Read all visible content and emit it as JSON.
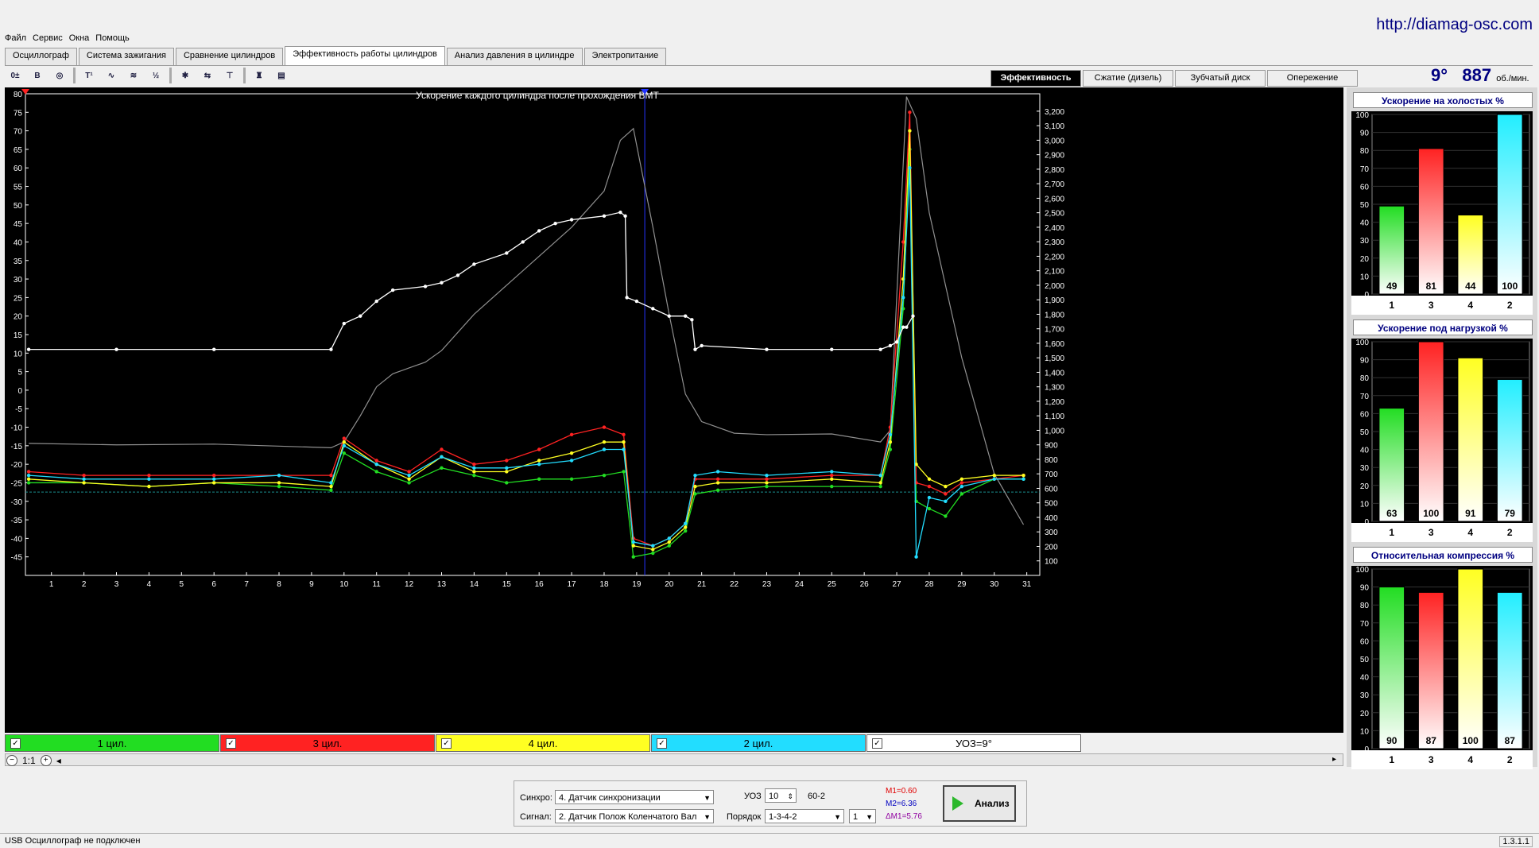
{
  "url": "http://diamag-osc.com",
  "menu": [
    "Файл",
    "Сервис",
    "Окна",
    "Помощь"
  ],
  "tabs": [
    {
      "label": "Осциллограф",
      "active": false
    },
    {
      "label": "Система зажигания",
      "active": false
    },
    {
      "label": "Сравнение цилиндров",
      "active": false
    },
    {
      "label": "Эффективность работы цилиндров",
      "active": true
    },
    {
      "label": "Анализ давления в цилиндре",
      "active": false
    },
    {
      "label": "Электропитание",
      "active": false
    }
  ],
  "toolbar_icons": [
    "zoom-tool-icon",
    "bold-b-icon",
    "rpm-icon",
    "t10-icon",
    "wave-icon",
    "vvti-icon",
    "alg-icon",
    "injector-icon",
    "timing-icon",
    "tdc-icon",
    "gauge-icon",
    "table-icon"
  ],
  "mode_tabs": [
    {
      "label": "Эффективность",
      "active": true
    },
    {
      "label": "Сжатие (дизель)",
      "active": false
    },
    {
      "label": "Зубчатый диск",
      "active": false
    },
    {
      "label": "Опережение",
      "active": false
    }
  ],
  "rpm": {
    "angle": "9°",
    "value": "887",
    "unit": "об./мин."
  },
  "chart_data": {
    "type": "line",
    "title": "Ускорение каждого цилиндра после прохождения ВМТ",
    "x_ticks": [
      "1",
      "2",
      "3",
      "4",
      "5",
      "6",
      "7",
      "8",
      "9",
      "10",
      "11",
      "12",
      "13",
      "14",
      "15",
      "16",
      "17",
      "18",
      "19",
      "20",
      "21",
      "22",
      "23",
      "24",
      "25",
      "26",
      "27",
      "28",
      "29",
      "30",
      "31"
    ],
    "xlim": [
      0.2,
      31.4
    ],
    "y_left_ticks": [
      "80",
      "75",
      "70",
      "65",
      "60",
      "55",
      "50",
      "45",
      "40",
      "35",
      "30",
      "25",
      "20",
      "15",
      "10",
      "5",
      "0",
      "-5",
      "-10",
      "-15",
      "-20",
      "-25",
      "-30",
      "-35",
      "-40",
      "-45"
    ],
    "ylim_left": [
      -50,
      80
    ],
    "y_right_ticks": [
      "3,200",
      "3,100",
      "3,000",
      "2,900",
      "2,800",
      "2,700",
      "2,600",
      "2,500",
      "2,400",
      "2,300",
      "2,200",
      "2,100",
      "2,000",
      "1,900",
      "1,800",
      "1,700",
      "1,600",
      "1,500",
      "1,400",
      "1,300",
      "1,200",
      "1,100",
      "1,000",
      "900",
      "800",
      "700",
      "600",
      "500",
      "400",
      "300",
      "200",
      "100"
    ],
    "ylim_right": [
      0,
      3320
    ],
    "reference_line": -27.5,
    "cursor_x": 19.25,
    "series": [
      {
        "name": "1 цил.",
        "color": "#22dd22",
        "points": [
          [
            0.3,
            -25
          ],
          [
            2,
            -25
          ],
          [
            4,
            -26
          ],
          [
            6,
            -25
          ],
          [
            8,
            -26
          ],
          [
            9.6,
            -27
          ],
          [
            10,
            -17
          ],
          [
            11,
            -22
          ],
          [
            12,
            -25
          ],
          [
            13,
            -21
          ],
          [
            14,
            -23
          ],
          [
            15,
            -25
          ],
          [
            16,
            -24
          ],
          [
            17,
            -24
          ],
          [
            18,
            -23
          ],
          [
            18.6,
            -22
          ],
          [
            18.9,
            -45
          ],
          [
            19.5,
            -44
          ],
          [
            20,
            -42
          ],
          [
            20.5,
            -38
          ],
          [
            20.8,
            -28
          ],
          [
            21.5,
            -27
          ],
          [
            23,
            -26
          ],
          [
            25,
            -26
          ],
          [
            26.5,
            -26
          ],
          [
            26.8,
            -16
          ],
          [
            27.2,
            22
          ],
          [
            27.4,
            65
          ],
          [
            27.6,
            -30
          ],
          [
            28,
            -32
          ],
          [
            28.5,
            -34
          ],
          [
            29,
            -28
          ],
          [
            30,
            -24
          ],
          [
            30.9,
            -24
          ]
        ]
      },
      {
        "name": "3 цил.",
        "color": "#ff2222",
        "points": [
          [
            0.3,
            -22
          ],
          [
            2,
            -23
          ],
          [
            4,
            -23
          ],
          [
            6,
            -23
          ],
          [
            8,
            -23
          ],
          [
            9.6,
            -23
          ],
          [
            10,
            -13
          ],
          [
            11,
            -19
          ],
          [
            12,
            -22
          ],
          [
            13,
            -16
          ],
          [
            14,
            -20
          ],
          [
            15,
            -19
          ],
          [
            16,
            -16
          ],
          [
            17,
            -12
          ],
          [
            18,
            -10
          ],
          [
            18.6,
            -12
          ],
          [
            18.9,
            -40
          ],
          [
            19.5,
            -42
          ],
          [
            20,
            -40
          ],
          [
            20.5,
            -36
          ],
          [
            20.8,
            -24
          ],
          [
            21.5,
            -24
          ],
          [
            23,
            -24
          ],
          [
            25,
            -23
          ],
          [
            26.5,
            -23
          ],
          [
            26.8,
            -10
          ],
          [
            27.2,
            40
          ],
          [
            27.4,
            75
          ],
          [
            27.6,
            -25
          ],
          [
            28,
            -26
          ],
          [
            28.5,
            -28
          ],
          [
            29,
            -25
          ],
          [
            30,
            -24
          ],
          [
            30.9,
            -23
          ]
        ]
      },
      {
        "name": "4 цил.",
        "color": "#ffff22",
        "points": [
          [
            0.3,
            -24
          ],
          [
            2,
            -25
          ],
          [
            4,
            -26
          ],
          [
            6,
            -25
          ],
          [
            8,
            -25
          ],
          [
            9.6,
            -26
          ],
          [
            10,
            -14
          ],
          [
            11,
            -20
          ],
          [
            12,
            -24
          ],
          [
            13,
            -18
          ],
          [
            14,
            -22
          ],
          [
            15,
            -22
          ],
          [
            16,
            -19
          ],
          [
            17,
            -17
          ],
          [
            18,
            -14
          ],
          [
            18.6,
            -14
          ],
          [
            18.9,
            -42
          ],
          [
            19.5,
            -43
          ],
          [
            20,
            -41
          ],
          [
            20.5,
            -37
          ],
          [
            20.8,
            -26
          ],
          [
            21.5,
            -25
          ],
          [
            23,
            -25
          ],
          [
            25,
            -24
          ],
          [
            26.5,
            -25
          ],
          [
            26.8,
            -14
          ],
          [
            27.2,
            30
          ],
          [
            27.4,
            70
          ],
          [
            27.6,
            -20
          ],
          [
            28,
            -24
          ],
          [
            28.5,
            -26
          ],
          [
            29,
            -24
          ],
          [
            30,
            -23
          ],
          [
            30.9,
            -23
          ]
        ]
      },
      {
        "name": "2 цил.",
        "color": "#22ddff",
        "points": [
          [
            0.3,
            -23
          ],
          [
            2,
            -24
          ],
          [
            4,
            -24
          ],
          [
            6,
            -24
          ],
          [
            8,
            -23
          ],
          [
            9.6,
            -25
          ],
          [
            10,
            -15
          ],
          [
            11,
            -20
          ],
          [
            12,
            -23
          ],
          [
            13,
            -18
          ],
          [
            14,
            -21
          ],
          [
            15,
            -21
          ],
          [
            16,
            -20
          ],
          [
            17,
            -19
          ],
          [
            18,
            -16
          ],
          [
            18.6,
            -16
          ],
          [
            18.9,
            -41
          ],
          [
            19.5,
            -42
          ],
          [
            20,
            -40
          ],
          [
            20.5,
            -36
          ],
          [
            20.8,
            -23
          ],
          [
            21.5,
            -22
          ],
          [
            23,
            -23
          ],
          [
            25,
            -22
          ],
          [
            26.5,
            -23
          ],
          [
            26.8,
            -12
          ],
          [
            27.2,
            25
          ],
          [
            27.4,
            60
          ],
          [
            27.6,
            -45
          ],
          [
            28,
            -29
          ],
          [
            28.5,
            -30
          ],
          [
            29,
            -26
          ],
          [
            30,
            -24
          ],
          [
            30.9,
            -24
          ]
        ]
      },
      {
        "name": "УОЗ=9°",
        "color": "#ffffff",
        "points": [
          [
            0.3,
            11
          ],
          [
            3,
            11
          ],
          [
            6,
            11
          ],
          [
            9.6,
            11
          ],
          [
            10,
            18
          ],
          [
            10.5,
            20
          ],
          [
            11,
            24
          ],
          [
            11.5,
            27
          ],
          [
            12.5,
            28
          ],
          [
            13,
            29
          ],
          [
            13.5,
            31
          ],
          [
            14,
            34
          ],
          [
            15,
            37
          ],
          [
            15.5,
            40
          ],
          [
            16,
            43
          ],
          [
            16.5,
            45
          ],
          [
            17,
            46
          ],
          [
            18,
            47
          ],
          [
            18.5,
            48
          ],
          [
            18.65,
            47
          ],
          [
            18.7,
            25
          ],
          [
            19,
            24
          ],
          [
            19.5,
            22
          ],
          [
            20,
            20
          ],
          [
            20.5,
            20
          ],
          [
            20.7,
            19
          ],
          [
            20.8,
            11
          ],
          [
            21,
            12
          ],
          [
            23,
            11
          ],
          [
            25,
            11
          ],
          [
            26.5,
            11
          ],
          [
            26.8,
            12
          ],
          [
            27,
            13
          ],
          [
            27.2,
            17
          ],
          [
            27.3,
            17
          ],
          [
            27.5,
            20
          ]
        ]
      }
    ],
    "rpm_series": {
      "name": "об./мин.",
      "color": "#909090",
      "points": [
        [
          0.3,
          910
        ],
        [
          3,
          900
        ],
        [
          6,
          905
        ],
        [
          9.6,
          880
        ],
        [
          10,
          920
        ],
        [
          10.5,
          1100
        ],
        [
          11,
          1300
        ],
        [
          11.5,
          1390
        ],
        [
          12,
          1430
        ],
        [
          12.5,
          1470
        ],
        [
          13,
          1550
        ],
        [
          14,
          1800
        ],
        [
          15,
          2000
        ],
        [
          16,
          2200
        ],
        [
          17,
          2400
        ],
        [
          18,
          2650
        ],
        [
          18.5,
          3000
        ],
        [
          18.9,
          3080
        ],
        [
          19.5,
          2400
        ],
        [
          20,
          1800
        ],
        [
          20.5,
          1250
        ],
        [
          21,
          1060
        ],
        [
          22,
          980
        ],
        [
          23,
          970
        ],
        [
          25,
          975
        ],
        [
          26.5,
          920
        ],
        [
          26.8,
          1000
        ],
        [
          27.3,
          3300
        ],
        [
          27.6,
          3150
        ],
        [
          28,
          2500
        ],
        [
          29,
          1500
        ],
        [
          30,
          700
        ],
        [
          30.9,
          350
        ]
      ]
    }
  },
  "legend": [
    {
      "label": "1 цил.",
      "color": "#22dd22",
      "checked": true
    },
    {
      "label": "3 цил.",
      "color": "#ff2222",
      "checked": true
    },
    {
      "label": "4 цил.",
      "color": "#ffff22",
      "checked": true
    },
    {
      "label": "2 цил.",
      "color": "#22ddff",
      "checked": true
    },
    {
      "label": "УОЗ=9°",
      "color": "#ffffff",
      "checked": true
    }
  ],
  "zoom_label": "1:1",
  "bar_panels": [
    {
      "title": "Ускорение на холостых %",
      "ticks": [
        "100",
        "90",
        "80",
        "70",
        "60",
        "50",
        "40",
        "30",
        "20",
        "10",
        "0"
      ],
      "bars": [
        {
          "cyl": "1",
          "value": 49,
          "color": "#22dd22"
        },
        {
          "cyl": "3",
          "value": 81,
          "color": "#ff2222"
        },
        {
          "cyl": "4",
          "value": 44,
          "color": "#ffff22"
        },
        {
          "cyl": "2",
          "value": 100,
          "color": "#22eeff"
        }
      ]
    },
    {
      "title": "Ускорение под нагрузкой %",
      "ticks": [
        "100",
        "90",
        "80",
        "70",
        "60",
        "50",
        "40",
        "30",
        "20",
        "10",
        "0"
      ],
      "bars": [
        {
          "cyl": "1",
          "value": 63,
          "color": "#22dd22"
        },
        {
          "cyl": "3",
          "value": 100,
          "color": "#ff2222"
        },
        {
          "cyl": "4",
          "value": 91,
          "color": "#ffff22"
        },
        {
          "cyl": "2",
          "value": 79,
          "color": "#22eeff"
        }
      ]
    },
    {
      "title": "Относительная компрессия %",
      "ticks": [
        "100",
        "90",
        "80",
        "70",
        "60",
        "50",
        "40",
        "30",
        "20",
        "10",
        "0"
      ],
      "bars": [
        {
          "cyl": "1",
          "value": 90,
          "color": "#22dd22"
        },
        {
          "cyl": "3",
          "value": 87,
          "color": "#ff2222"
        },
        {
          "cyl": "4",
          "value": 100,
          "color": "#ffff22"
        },
        {
          "cyl": "2",
          "value": 87,
          "color": "#22eeff"
        }
      ]
    }
  ],
  "controls": {
    "sync_label": "Синхро:",
    "sync_value": "4.  Датчик синхронизации",
    "signal_label": "Сигнал:",
    "signal_value": "2.  Датчик Полож Коленчатого Вал",
    "uoz_label": "УОЗ",
    "uoz_value": "10",
    "teeth": "60-2",
    "order_label": "Порядок",
    "order_value": "1-3-4-2",
    "order_num": "1",
    "m1": "M1=0.60",
    "m2": "M2=6.36",
    "dm1": "ΔM1=5.76",
    "analyze_label": "Анализ"
  },
  "status": {
    "text": "USB Осциллограф не подключен",
    "version": "1.3.1.1"
  }
}
